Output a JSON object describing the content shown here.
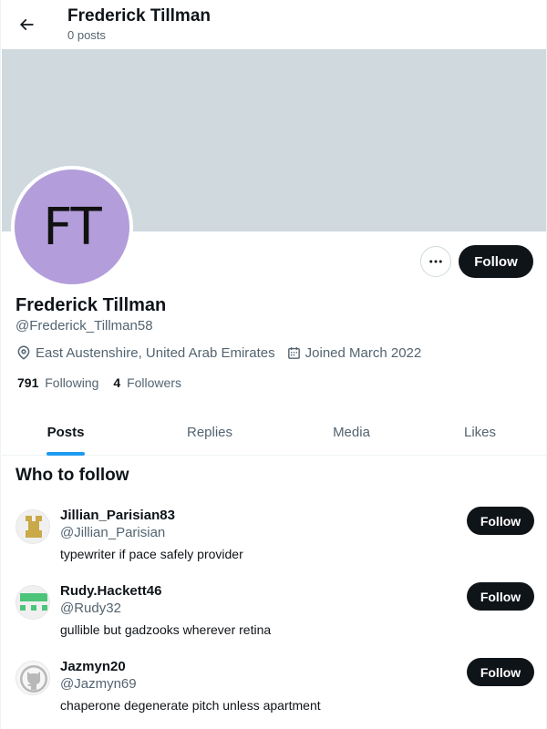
{
  "header": {
    "title": "Frederick Tillman",
    "post_count": "0 posts"
  },
  "profile": {
    "initials": "FT",
    "avatar_color": "#b39ddb",
    "banner_color": "#cfd9de",
    "name": "Frederick Tillman",
    "handle": "@Frederick_Tillman58",
    "location": "East Austenshire, United Arab Emirates",
    "joined": "Joined March 2022",
    "following_count": "791",
    "following_label": "Following",
    "followers_count": "4",
    "followers_label": "Followers",
    "follow_label": "Follow"
  },
  "tabs": [
    {
      "label": "Posts",
      "active": true
    },
    {
      "label": "Replies",
      "active": false
    },
    {
      "label": "Media",
      "active": false
    },
    {
      "label": "Likes",
      "active": false
    }
  ],
  "who_to_follow": {
    "title": "Who to follow",
    "suggestions": [
      {
        "name": "Jillian_Parisian83",
        "handle": "@Jillian_Parisian",
        "bio": "typewriter if pace safely provider",
        "follow_label": "Follow",
        "avatar_icon": "identicon-gold"
      },
      {
        "name": "Rudy.Hackett46",
        "handle": "@Rudy32",
        "bio": "gullible but gadzooks wherever retina",
        "follow_label": "Follow",
        "avatar_icon": "identicon-green"
      },
      {
        "name": "Jazmyn20",
        "handle": "@Jazmyn69",
        "bio": "chaperone degenerate pitch unless apartment",
        "follow_label": "Follow",
        "avatar_icon": "github-octocat"
      }
    ]
  }
}
